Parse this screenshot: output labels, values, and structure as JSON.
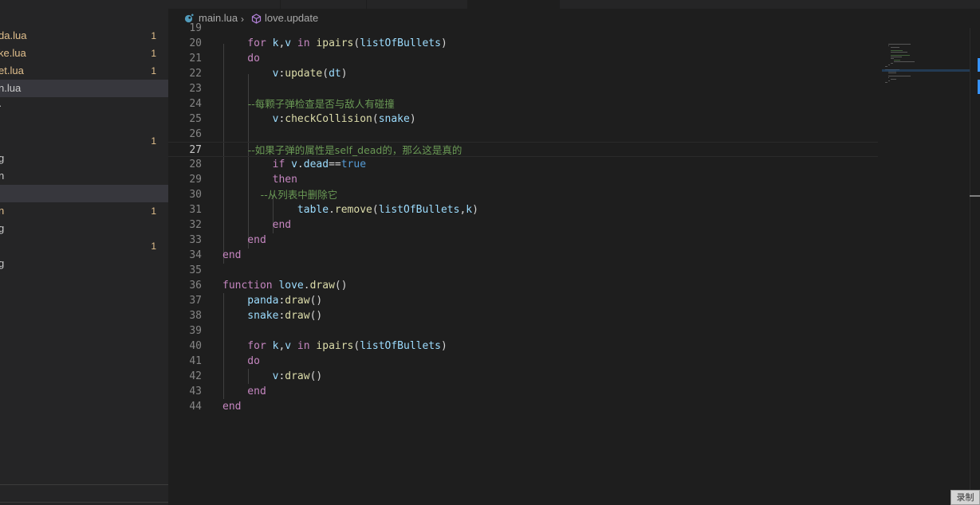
{
  "sidebar": {
    "rows": [
      {
        "name": "da.lua",
        "badge": "1",
        "modified": true,
        "selected": false
      },
      {
        "name": "ke.lua",
        "badge": "1",
        "modified": true,
        "selected": false
      },
      {
        "name": "et.lua",
        "badge": "1",
        "modified": true,
        "selected": false
      },
      {
        "name": "n.lua",
        "badge": "",
        "modified": false,
        "selected": true
      },
      {
        "name": "·",
        "badge": "",
        "modified": false,
        "selected": false
      },
      {
        "name": "",
        "badge": "",
        "modified": false,
        "selected": false
      },
      {
        "name": "",
        "badge": "1",
        "modified": true,
        "selected": false
      },
      {
        "name": "g",
        "badge": "",
        "modified": false,
        "selected": false
      },
      {
        "name": "n",
        "badge": "",
        "modified": false,
        "selected": false
      },
      {
        "name": "",
        "badge": "",
        "modified": false,
        "selected": true
      },
      {
        "name": "n",
        "badge": "1",
        "modified": true,
        "selected": false
      },
      {
        "name": "g",
        "badge": "",
        "modified": false,
        "selected": false
      },
      {
        "name": "",
        "badge": "1",
        "modified": true,
        "selected": false
      },
      {
        "name": "g",
        "badge": "",
        "modified": false,
        "selected": false
      }
    ]
  },
  "breadcrumb": {
    "file": "main.lua",
    "symbol": "love.update",
    "file_icon": "lua-file-icon",
    "symbol_icon": "method-icon"
  },
  "editor": {
    "current_line": 27,
    "lines": [
      {
        "n": "19",
        "tokens": []
      },
      {
        "n": "20",
        "tokens": [
          [
            "kw",
            "    for "
          ],
          [
            "var",
            "k"
          ],
          [
            "pl",
            ","
          ],
          [
            "var",
            "v"
          ],
          [
            "kw",
            " in "
          ],
          [
            "fn",
            "ipairs"
          ],
          [
            "pl",
            "("
          ],
          [
            "var",
            "listOfBullets"
          ],
          [
            "pl",
            ")"
          ]
        ]
      },
      {
        "n": "21",
        "tokens": [
          [
            "kw",
            "    do"
          ]
        ]
      },
      {
        "n": "22",
        "tokens": [
          [
            "var",
            "        v"
          ],
          [
            "pl",
            ":"
          ],
          [
            "fn",
            "update"
          ],
          [
            "pl",
            "("
          ],
          [
            "var",
            "dt"
          ],
          [
            "pl",
            ")"
          ]
        ]
      },
      {
        "n": "23",
        "tokens": []
      },
      {
        "n": "24",
        "tokens": [
          [
            "cm",
            "        --每颗子弹检查是否与敌人有碰撞"
          ]
        ]
      },
      {
        "n": "25",
        "tokens": [
          [
            "var",
            "        v"
          ],
          [
            "pl",
            ":"
          ],
          [
            "fn",
            "checkCollision"
          ],
          [
            "pl",
            "("
          ],
          [
            "var",
            "snake"
          ],
          [
            "pl",
            ")"
          ]
        ]
      },
      {
        "n": "26",
        "tokens": []
      },
      {
        "n": "27",
        "tokens": [
          [
            "cm",
            "        --如果子弹的属性是self_dead的，那么这是真的"
          ]
        ]
      },
      {
        "n": "28",
        "tokens": [
          [
            "kw",
            "        if "
          ],
          [
            "var",
            "v"
          ],
          [
            "pl",
            "."
          ],
          [
            "var",
            "dead"
          ],
          [
            "pl",
            "=="
          ],
          [
            "kwb",
            "true"
          ]
        ]
      },
      {
        "n": "29",
        "tokens": [
          [
            "kw",
            "        then"
          ]
        ]
      },
      {
        "n": "30",
        "tokens": [
          [
            "cm",
            "            --从列表中删除它"
          ]
        ]
      },
      {
        "n": "31",
        "tokens": [
          [
            "var",
            "            table"
          ],
          [
            "pl",
            "."
          ],
          [
            "fn",
            "remove"
          ],
          [
            "pl",
            "("
          ],
          [
            "var",
            "listOfBullets"
          ],
          [
            "pl",
            ","
          ],
          [
            "var",
            "k"
          ],
          [
            "pl",
            ")"
          ]
        ]
      },
      {
        "n": "32",
        "tokens": [
          [
            "kw",
            "        end"
          ]
        ]
      },
      {
        "n": "33",
        "tokens": [
          [
            "kw",
            "    end"
          ]
        ]
      },
      {
        "n": "34",
        "tokens": [
          [
            "kw",
            "end"
          ]
        ]
      },
      {
        "n": "35",
        "tokens": []
      },
      {
        "n": "36",
        "tokens": [
          [
            "kw",
            "function "
          ],
          [
            "var",
            "love"
          ],
          [
            "pl",
            "."
          ],
          [
            "fn",
            "draw"
          ],
          [
            "pl",
            "()"
          ]
        ]
      },
      {
        "n": "37",
        "tokens": [
          [
            "var",
            "    panda"
          ],
          [
            "pl",
            ":"
          ],
          [
            "fn",
            "draw"
          ],
          [
            "pl",
            "()"
          ]
        ]
      },
      {
        "n": "38",
        "tokens": [
          [
            "var",
            "    snake"
          ],
          [
            "pl",
            ":"
          ],
          [
            "fn",
            "draw"
          ],
          [
            "pl",
            "()"
          ]
        ]
      },
      {
        "n": "39",
        "tokens": []
      },
      {
        "n": "40",
        "tokens": [
          [
            "kw",
            "    for "
          ],
          [
            "var",
            "k"
          ],
          [
            "pl",
            ","
          ],
          [
            "var",
            "v"
          ],
          [
            "kw",
            " in "
          ],
          [
            "fn",
            "ipairs"
          ],
          [
            "pl",
            "("
          ],
          [
            "var",
            "listOfBullets"
          ],
          [
            "pl",
            ")"
          ]
        ]
      },
      {
        "n": "41",
        "tokens": [
          [
            "kw",
            "    do"
          ]
        ]
      },
      {
        "n": "42",
        "tokens": [
          [
            "var",
            "        v"
          ],
          [
            "pl",
            ":"
          ],
          [
            "fn",
            "draw"
          ],
          [
            "pl",
            "()"
          ]
        ]
      },
      {
        "n": "43",
        "tokens": [
          [
            "kw",
            "    end"
          ]
        ]
      },
      {
        "n": "44",
        "tokens": [
          [
            "kw",
            "end"
          ]
        ]
      }
    ]
  },
  "overlay": {
    "record_button": "录制"
  },
  "colors": {
    "keyword": "#c586c0",
    "boolean": "#569cd6",
    "function": "#dcdcaa",
    "variable": "#9cdcfe",
    "comment": "#6a9955",
    "modified": "#e2c08d",
    "background": "#1e1e1e",
    "sidebar": "#252526"
  }
}
